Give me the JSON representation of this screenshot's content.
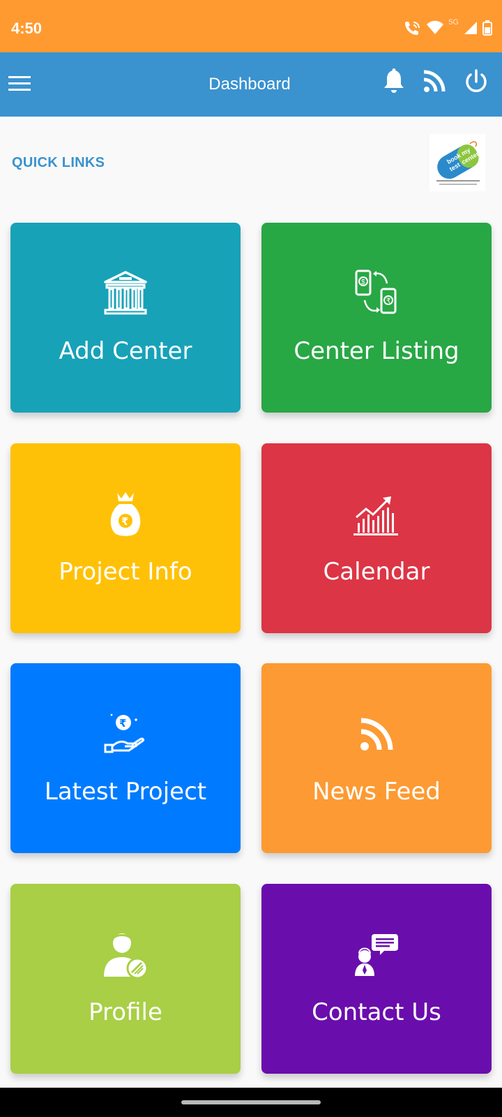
{
  "status_bar": {
    "time": "4:50",
    "network": "5G",
    "background_color": "#ff9a30"
  },
  "app_bar": {
    "title": "Dashboard",
    "background_color": "#3a92cf",
    "icons": [
      "menu-icon",
      "bell-icon",
      "rss-icon",
      "power-icon"
    ]
  },
  "section": {
    "heading": "QUICK LINKS",
    "logo_text": "book my test center"
  },
  "tiles": [
    {
      "label": "Add Center",
      "icon": "bank-icon",
      "color": "#17a2b8"
    },
    {
      "label": "Center Listing",
      "icon": "phone-transfer-icon",
      "color": "#28a745"
    },
    {
      "label": "Project Info",
      "icon": "money-bag-icon",
      "color": "#ffc107"
    },
    {
      "label": "Calendar",
      "icon": "growth-chart-icon",
      "color": "#dc3545"
    },
    {
      "label": "Latest Project",
      "icon": "coin-hand-icon",
      "color": "#007bff"
    },
    {
      "label": "News Feed",
      "icon": "rss-icon",
      "color": "#fd9a33"
    },
    {
      "label": "Profile",
      "icon": "user-profile-icon",
      "color": "#a8cf45"
    },
    {
      "label": "Contact Us",
      "icon": "support-chat-icon",
      "color": "#6a0dad"
    }
  ]
}
